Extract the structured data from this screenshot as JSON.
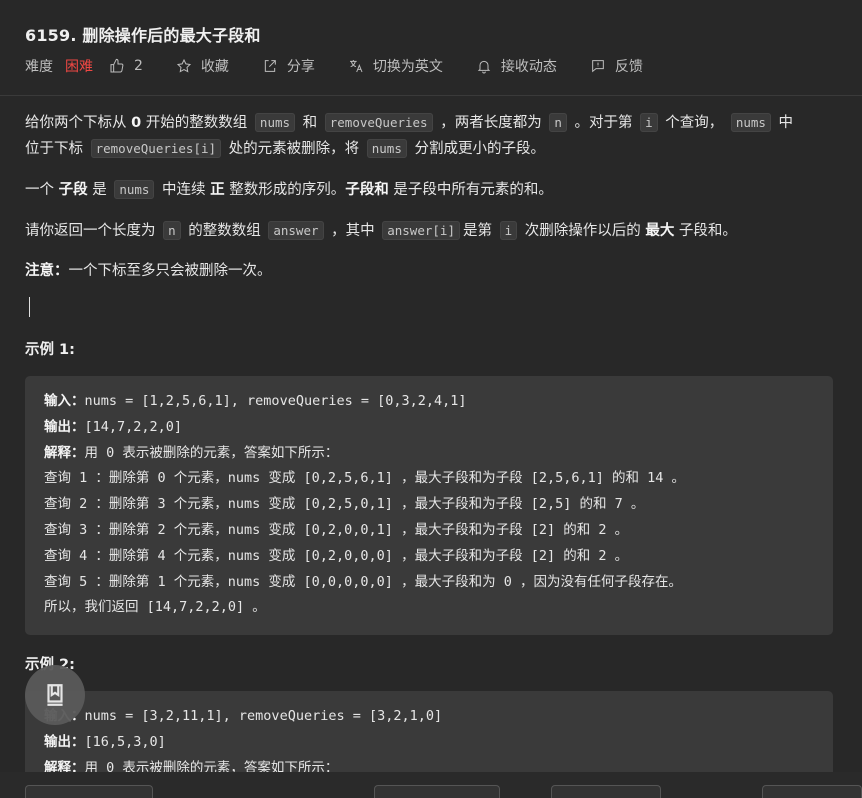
{
  "problem": {
    "title": "6159. 删除操作后的最大子段和",
    "difficulty_label": "难度",
    "difficulty_value": "困难",
    "likes": "2",
    "favorite": "收藏",
    "share": "分享",
    "switch_lang": "切换为英文",
    "notify": "接收动态",
    "feedback": "反馈"
  },
  "description": {
    "p1": {
      "t1": "给你两个下标从 ",
      "b1": "0",
      "t2": " 开始的整数数组 ",
      "c1": "nums",
      "t3": " 和 ",
      "c2": "removeQueries",
      "t4": " ，两者长度都为 ",
      "c3": "n",
      "t5": " 。对于第 ",
      "c4": "i",
      "t6": " 个查询， ",
      "c5": "nums",
      "t7": " 中",
      "t8": "位于下标 ",
      "c6": "removeQueries[i]",
      "t9": " 处的元素被删除，将 ",
      "c7": "nums",
      "t10": " 分割成更小的子段。"
    },
    "p2": {
      "t1": "一个 ",
      "b1": "子段",
      "t2": " 是 ",
      "c1": "nums",
      "t3": " 中连续 ",
      "b2": "正",
      "t4": " 整数形成的序列。",
      "b3": "子段和",
      "t5": " 是子段中所有元素的和。"
    },
    "p3": {
      "t1": "请你返回一个长度为 ",
      "c1": "n",
      "t2": " 的整数数组 ",
      "c2": "answer",
      "t3": " ，其中 ",
      "c3": "answer[i]",
      "t4": "是第 ",
      "c4": "i",
      "t5": " 次删除操作以后的 ",
      "b1": "最大",
      "t6": " 子段和。"
    },
    "p4": {
      "b1": "注意：",
      "t1": "一个下标至多只会被删除一次。"
    }
  },
  "example1": {
    "title": "示例 1:",
    "input_label": "输入：",
    "input": "nums = [1,2,5,6,1], removeQueries = [0,3,2,4,1]",
    "output_label": "输出：",
    "output": "[14,7,2,2,0]",
    "explain_label": "解释：",
    "explain": "用 0 表示被删除的元素，答案如下所示：",
    "lines": [
      "查询 1 ：删除第 0 个元素，nums 变成 [0,2,5,6,1] ，最大子段和为子段 [2,5,6,1] 的和 14 。",
      "查询 2 ：删除第 3 个元素，nums 变成 [0,2,5,0,1] ，最大子段和为子段 [2,5] 的和 7 。",
      "查询 3 ：删除第 2 个元素，nums 变成 [0,2,0,0,1] ，最大子段和为子段 [2] 的和 2 。",
      "查询 4 ：删除第 4 个元素，nums 变成 [0,2,0,0,0] ，最大子段和为子段 [2] 的和 2 。",
      "查询 5 ：删除第 1 个元素，nums 变成 [0,0,0,0,0] ，最大子段和为 0 ，因为没有任何子段存在。",
      "所以，我们返回 [14,7,2,2,0] 。"
    ]
  },
  "example2": {
    "title": "示例 2:",
    "input_label": "输入：",
    "input": "nums = [3,2,11,1], removeQueries = [3,2,1,0]",
    "output_label": "输出：",
    "output": "[16,5,3,0]",
    "explain_label": "解释：",
    "explain": "用 0 表示被删除的元素，答案如下所示："
  },
  "icons": {
    "like": "thumbs-up-icon",
    "favorite": "star-icon",
    "share": "share-icon",
    "translate": "translate-icon",
    "notify": "bell-icon",
    "feedback": "feedback-icon",
    "notes": "notebook-icon"
  },
  "colors": {
    "hard": "#ef4743",
    "background": "#282828",
    "code_block": "#3a3a3a"
  }
}
